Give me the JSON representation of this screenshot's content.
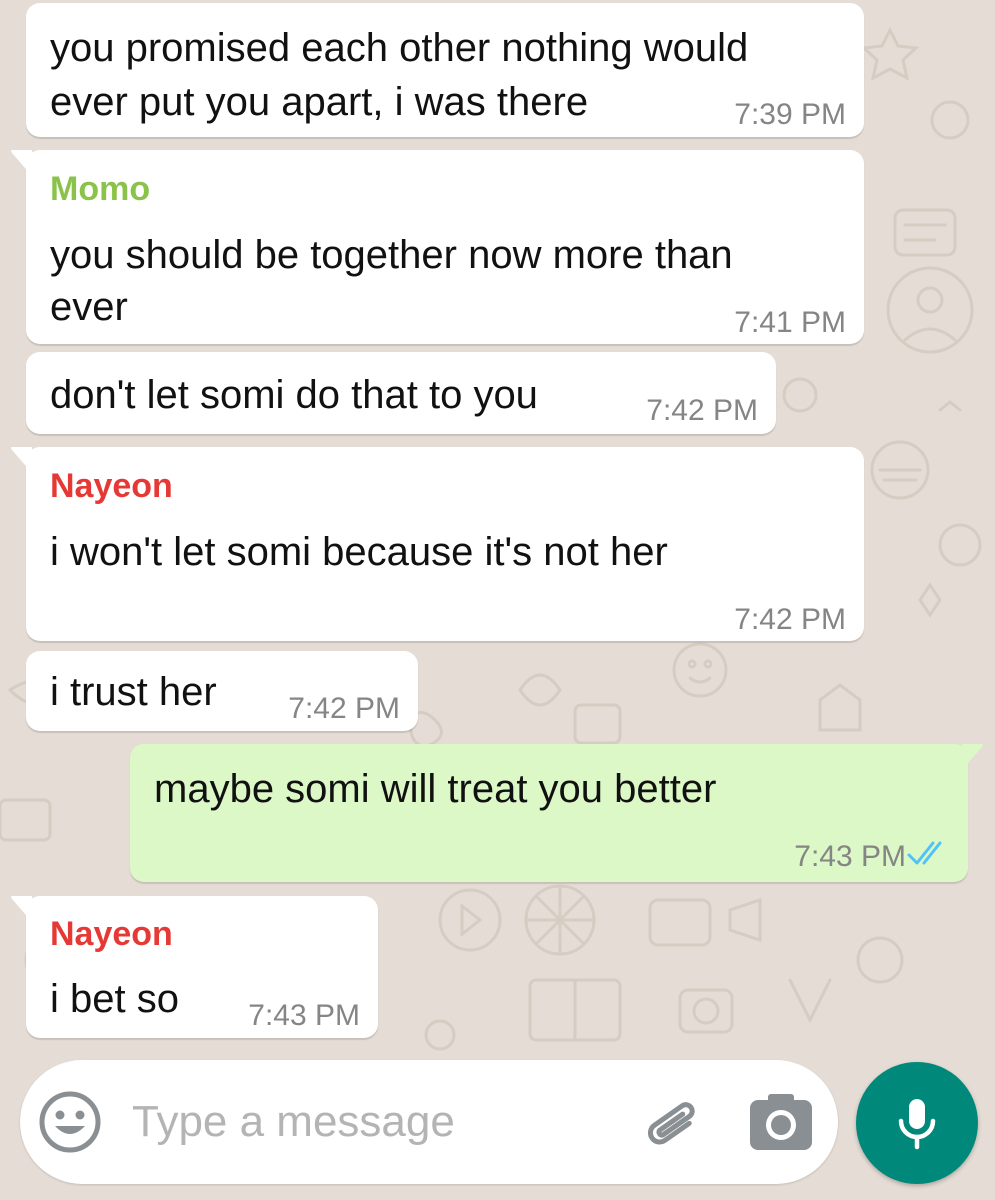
{
  "colors": {
    "background": "#e5ddd5",
    "incoming_bubble": "#ffffff",
    "outgoing_bubble": "#dcf8c6",
    "timestamp": "#858585",
    "read_ticks": "#4fc3f7",
    "mic_button": "#00897b",
    "placeholder": "#b4b4b4"
  },
  "messages": [
    {
      "direction": "incoming",
      "sender": "",
      "lines": [
        "you promised each other nothing would",
        "ever put you apart, i was there"
      ],
      "time": "7:39 PM"
    },
    {
      "direction": "incoming",
      "sender": "Momo",
      "sender_color": "#8bc34a",
      "lines": [
        "you should be together now more than",
        "ever"
      ],
      "time": "7:41 PM"
    },
    {
      "direction": "incoming",
      "sender": "",
      "lines": [
        "don't let somi do that to you"
      ],
      "time": "7:42 PM"
    },
    {
      "direction": "incoming",
      "sender": "Nayeon",
      "sender_color": "#e53935",
      "lines": [
        "i won't let somi because it's not her"
      ],
      "time": "7:42 PM"
    },
    {
      "direction": "incoming",
      "sender": "",
      "lines": [
        "i trust her"
      ],
      "time": "7:42 PM"
    },
    {
      "direction": "outgoing",
      "sender": "",
      "lines": [
        "maybe somi will treat you better"
      ],
      "time": "7:43 PM",
      "status": "read",
      "status_icon": "double-check-icon"
    },
    {
      "direction": "incoming",
      "sender": "Nayeon",
      "sender_color": "#e53935",
      "lines": [
        "i bet so"
      ],
      "time": "7:43 PM"
    }
  ],
  "composer": {
    "placeholder": "Type a message",
    "value": "",
    "emoji_icon": "emoji-icon",
    "attach_icon": "paperclip-icon",
    "camera_icon": "camera-icon",
    "send_icon": "microphone-icon"
  }
}
